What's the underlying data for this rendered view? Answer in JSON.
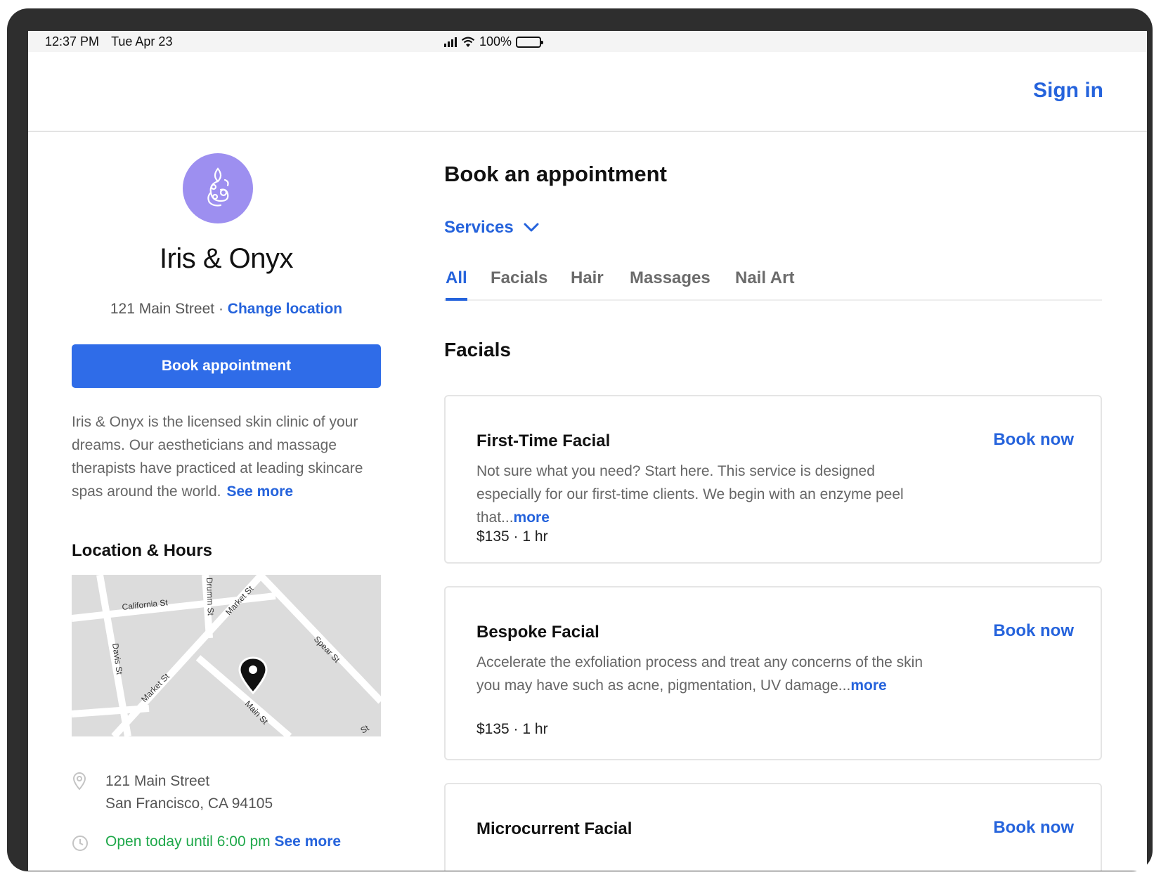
{
  "status_bar": {
    "time": "12:37 PM",
    "date": "Tue Apr 23",
    "battery": "100%",
    "battery_level": 1.0
  },
  "header": {
    "sign_in_label": "Sign in"
  },
  "business": {
    "name": "Iris & Onyx",
    "address_short": "121 Main Street",
    "separator": " · ",
    "change_location_label": "Change location",
    "book_button_label": "Book appointment",
    "description": "Iris & Onyx is the licensed skin clinic of your dreams. Our aestheticians and massage therapists have practiced at leading skincare spas around the world.",
    "see_more_label": "See more",
    "logo_color": "#9d8ff0"
  },
  "location": {
    "title": "Location & Hours",
    "street_labels": [
      "California St",
      "Drumm St",
      "Market St",
      "Spear St",
      "Davis St",
      "Market St",
      "Main St",
      "St"
    ],
    "address_line1": "121 Main Street",
    "address_line2": "San Francisco, CA 94105",
    "hours_text": "Open today until 6:00 pm",
    "hours_link": "See more"
  },
  "booking": {
    "title": "Book an appointment",
    "services_dropdown": "Services",
    "tabs": [
      {
        "label": "All",
        "active": true
      },
      {
        "label": "Facials",
        "active": false
      },
      {
        "label": "Hair",
        "active": false
      },
      {
        "label": "Massages",
        "active": false
      },
      {
        "label": "Nail Art",
        "active": false
      }
    ],
    "section_title": "Facials",
    "services": [
      {
        "name": "First-Time Facial",
        "book_label": "Book now",
        "description": "Not sure what you need? Start here. This service is designed especially for our first-time clients. We begin with an enzyme peel that...",
        "more_label": "more",
        "price": "$135 · 1 hr"
      },
      {
        "name": "Bespoke Facial",
        "book_label": "Book now",
        "description": "Accelerate the exfoliation process and treat any concerns of the skin you may have such as acne, pigmentation, UV damage...",
        "more_label": "more",
        "price": "$135 · 1 hr"
      },
      {
        "name": "Microcurrent Facial",
        "book_label": "Book now"
      }
    ]
  },
  "colors": {
    "accent": "#2563dc",
    "button": "#2f6ce8",
    "open_status": "#1fa84a"
  }
}
